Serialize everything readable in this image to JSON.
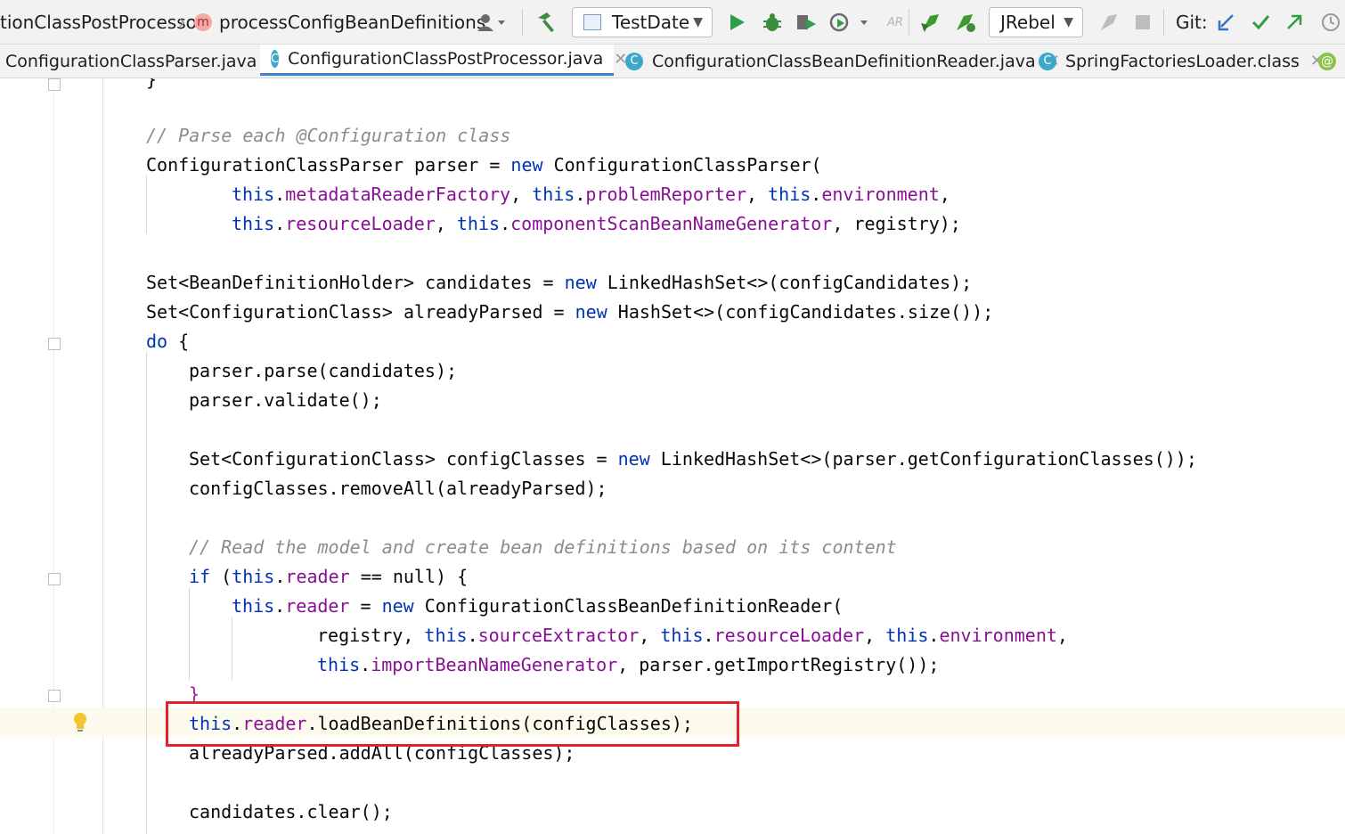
{
  "breadcrumb": {
    "class_name": "tionClassPostProcessor",
    "method_badge": "m",
    "method_name": "processConfigBeanDefinitions"
  },
  "toolbar": {
    "run_config": "TestDate",
    "jrebel": "JRebel",
    "git_label": "Git:",
    "ar_label": "AR"
  },
  "tabs": [
    {
      "label": "ConfigurationClassParser.java",
      "active": false
    },
    {
      "label": "ConfigurationClassPostProcessor.java",
      "active": true
    },
    {
      "label": "ConfigurationClassBeanDefinitionReader.java",
      "active": false
    },
    {
      "label": "SpringFactoriesLoader.class",
      "active": false
    }
  ],
  "tab_icon": "C",
  "colors": {
    "keyword": "#0033b3",
    "field": "#871094",
    "comment": "#8c8c8c",
    "highlight_box": "#e3222f",
    "active_tab_underline": "#4083c9"
  },
  "code": {
    "closing_brace": "}",
    "comment1": "// Parse each @Configuration class",
    "parser_decl": "ConfigurationClassParser parser = ",
    "new": "new",
    "ctor1": " ConfigurationClassParser(",
    "this": "this",
    "metadataReaderFactory": "metadataReaderFactory",
    "problemReporter": "problemReporter",
    "environment": "environment",
    "resourceLoader": "resourceLoader",
    "componentScanBeanNameGenerator": "componentScanBeanNameGenerator",
    "registry_end": "registry);",
    "candidates_decl": "Set<BeanDefinitionHolder> candidates = ",
    "candidates_init": " LinkedHashSet<>(configCandidates);",
    "parsed_decl": "Set<ConfigurationClass> alreadyParsed = ",
    "parsed_init": " HashSet<>(configCandidates.size());",
    "do": "do",
    "open_brace": " {",
    "parse": "parser.parse(candidates);",
    "validate": "parser.validate();",
    "configclasses_decl": "Set<ConfigurationClass> configClasses = ",
    "configclasses_init": " LinkedHashSet<>(parser.getConfigurationClasses());",
    "remove_all": "configClasses.removeAll(alreadyParsed);",
    "comment2": "// Read the model and create bean definitions based on its content",
    "if": "if",
    "reader": "reader",
    "if_rest": " == null) {",
    "reader_assign": " = ",
    "reader_ctor": " ConfigurationClassBeanDefinitionReader(",
    "registry": "registry, ",
    "sourceExtractor": "sourceExtractor",
    "importBeanNameGenerator": "importBeanNameGenerator",
    "import_registry": ", parser.getImportRegistry());",
    "load": ".loadBeanDefinitions(configClasses);",
    "add_all": "alreadyParsed.addAll(configClasses);",
    "clear": "candidates.clear();"
  }
}
